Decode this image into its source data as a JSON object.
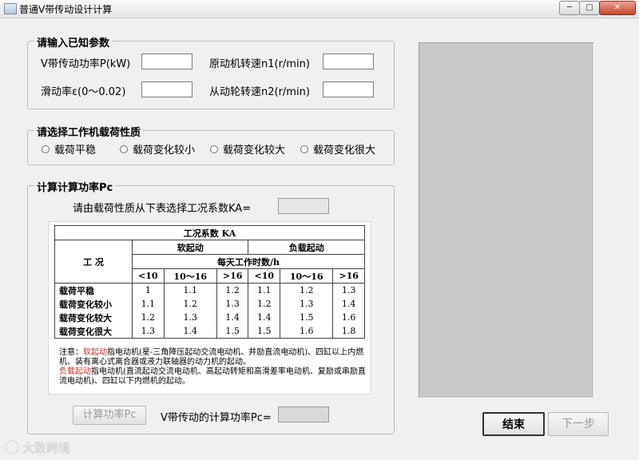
{
  "window": {
    "title": "普通V带传动设计计算"
  },
  "known_params": {
    "legend": "请输入已知参数",
    "power_label": "V带传动功率P(kW)",
    "power_value": "",
    "motor_speed_label": "原动机转速n1(r/min)",
    "motor_speed_value": "",
    "slip_label": "滑动率ε(0～0.02)",
    "slip_value": "",
    "driven_speed_label": "从动轮转速n2(r/min)",
    "driven_speed_value": ""
  },
  "load_type": {
    "legend": "请选择工作机载荷性质",
    "options": [
      "载荷平稳",
      "载荷变化较小",
      "载荷变化较大",
      "载荷变化很大"
    ]
  },
  "calc_power": {
    "legend": "计算计算功率Pc",
    "ka_prompt": "请由载荷性质从下表选择工况系数KA=",
    "ka_value": "",
    "calc_button": "计算功率Pc",
    "pc_label": "V带传动的计算功率Pc=",
    "pc_value": ""
  },
  "ka_table": {
    "caption": "工况系数 KA",
    "condition_header": "工  况",
    "soft_start": "软起动",
    "load_start": "负载起动",
    "hours_header": "每天工作时数/h",
    "hour_cols": [
      "<10",
      "10～16",
      ">16",
      "<10",
      "10～16",
      ">16"
    ],
    "rows": [
      {
        "name": "载荷平稳",
        "values": [
          "1",
          "1.1",
          "1.2",
          "1.1",
          "1.2",
          "1.3"
        ]
      },
      {
        "name": "载荷变化较小",
        "values": [
          "1.1",
          "1.2",
          "1.3",
          "1.2",
          "1.3",
          "1.4"
        ]
      },
      {
        "name": "载荷变化较大",
        "values": [
          "1.2",
          "1.3",
          "1.4",
          "1.4",
          "1.5",
          "1.6"
        ]
      },
      {
        "name": "载荷变化很大",
        "values": [
          "1.3",
          "1.4",
          "1.5",
          "1.5",
          "1.6",
          "1.8"
        ]
      }
    ],
    "note_prefix": "注意：",
    "note_soft_term": "软起动",
    "note_soft_text": "指电动机(星-三角降压起动交流电动机、并励直流电动机)、四缸以上内燃机、装有离心式离合器或液力联轴器的动力机的起动。",
    "note_load_term": "负载起动",
    "note_load_text": "指电动机(直流起动交流电动机、高起动转矩和高滑差率电动机、复励或串励直流电动机)、四缸以下内燃机的起动。"
  },
  "buttons": {
    "end": "结束",
    "next": "下一步"
  },
  "output": {
    "text": ""
  },
  "watermark": {
    "text": "大数跨境"
  }
}
